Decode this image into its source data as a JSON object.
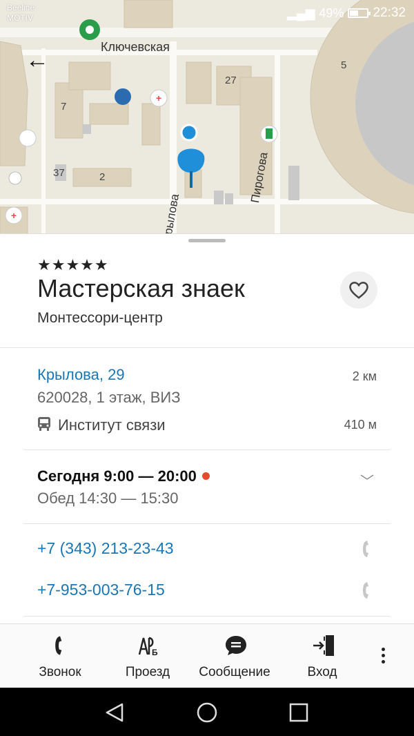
{
  "status_bar": {
    "carrier_line1": "Beeline",
    "carrier_line2": "MOTIV",
    "battery": "49%",
    "battery_level": 0.49,
    "time": "22:32"
  },
  "map": {
    "street_top": "Ключевская",
    "street_right": "Пирогова",
    "street_left": "рылова",
    "building_numbers": [
      "27",
      "7",
      "37",
      "2",
      "5"
    ],
    "colors": {
      "pin": "#1e8fd8",
      "ground": "#ece9df",
      "building": "#ddd3bd"
    }
  },
  "place": {
    "rating_stars": "★★★★★",
    "name": "Мастерская знаек",
    "category": "Монтессори-центр",
    "address": "Крылова, 29",
    "distance": "2 км",
    "address_details": "620028, 1 этаж, ВИЗ",
    "stop_name": "Институт связи",
    "stop_distance": "410 м",
    "hours_today": "Сегодня 9:00 — 20:00",
    "lunch": "Обед 14:30 — 15:30",
    "status_color": "#e64a2e",
    "phones": [
      "+7 (343) 213-23-43",
      "+7-953-003-76-15"
    ]
  },
  "actions": [
    {
      "label": "Звонок",
      "icon": "phone-icon"
    },
    {
      "label": "Проезд",
      "icon": "route-icon"
    },
    {
      "label": "Сообщение",
      "icon": "message-icon"
    },
    {
      "label": "Вход",
      "icon": "login-icon"
    }
  ]
}
